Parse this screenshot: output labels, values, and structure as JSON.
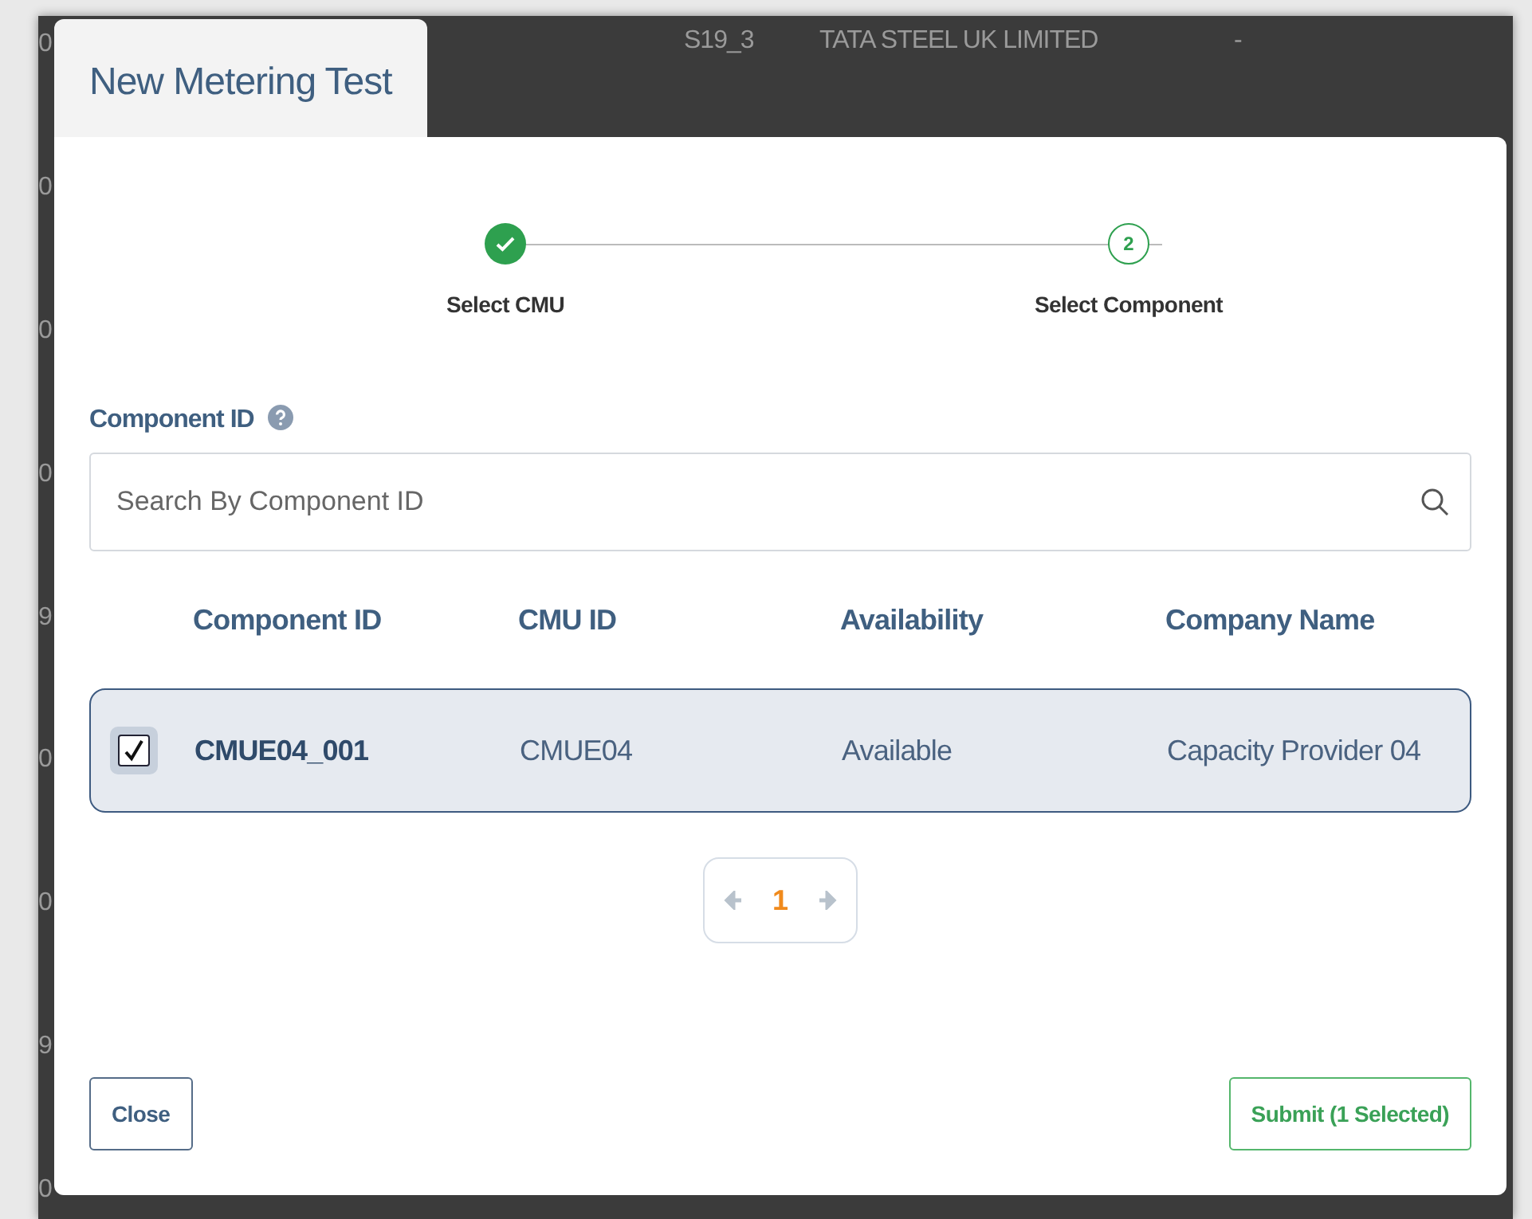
{
  "background": {
    "edge_marks": [
      "0",
      "0",
      "0",
      "0",
      "9",
      "0",
      "0",
      "9",
      "0"
    ],
    "top_row": [
      "S19_3",
      "TATA STEEL UK LIMITED",
      "-"
    ]
  },
  "modal": {
    "title": "New Metering Test",
    "steps": [
      {
        "label": "Select CMU",
        "completed": true
      },
      {
        "label": "Select Component",
        "completed": false,
        "number": "2"
      }
    ],
    "field_label": "Component ID",
    "search": {
      "placeholder": "Search By Component ID"
    },
    "table": {
      "columns": [
        "Component ID",
        "CMU ID",
        "Availability",
        "Company Name"
      ],
      "rows": [
        {
          "checked": true,
          "cells": [
            "CMUE04_001",
            "CMUE04",
            "Available",
            "Capacity Provider 04"
          ]
        }
      ]
    },
    "pagination": {
      "pages": [
        {
          "label": "1",
          "selected": true
        }
      ]
    },
    "buttons": [
      {
        "kind": "close",
        "label": "Close"
      },
      {
        "kind": "submit",
        "label": "Submit (1 Selected)"
      }
    ]
  }
}
